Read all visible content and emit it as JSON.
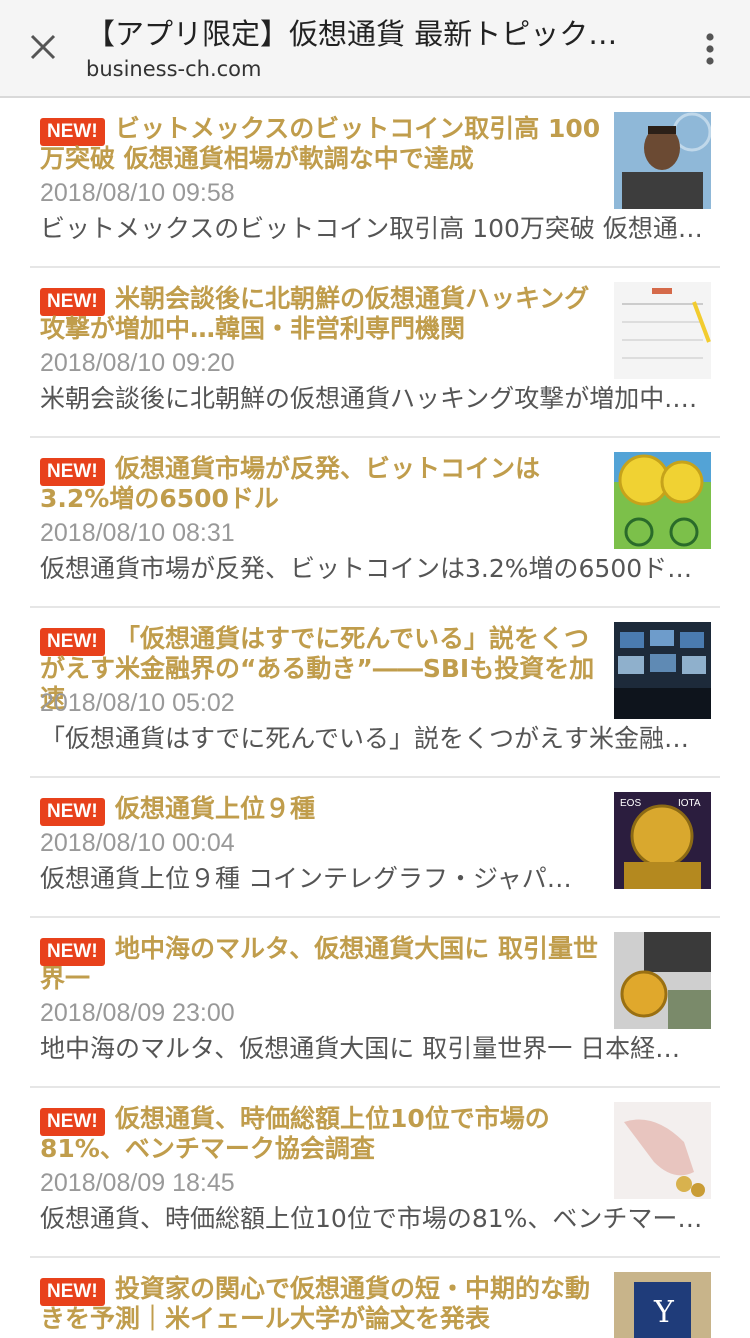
{
  "header": {
    "title": "【アプリ限定】仮想通貨 最新トピック …",
    "url": "business-ch.com"
  },
  "badge_label": "NEW!",
  "articles": [
    {
      "title": "ビットメックスのビットコイン取引高 100万突破 仮想通貨相場が軟調な中で達成",
      "date": "2018/08/10 09:58",
      "summary": "ビットメックスのビットコイン取引高 100万突破 仮想通…"
    },
    {
      "title": "米朝会談後に北朝鮮の仮想通貨ハッキング攻撃が増加中…韓国・非営利専門機関",
      "date": "2018/08/10 09:20",
      "summary": "米朝会談後に北朝鮮の仮想通貨ハッキング攻撃が増加中.…"
    },
    {
      "title": "仮想通貨市場が反発、ビットコインは3.2%増の6500ドル",
      "date": "2018/08/10 08:31",
      "summary": "仮想通貨市場が反発、ビットコインは3.2%増の6500ド…"
    },
    {
      "title": "「仮想通貨はすでに死んでいる」説をくつがえす米金融界の“ある動き”――SBIも投資を加速",
      "date": "2018/08/10 05:02",
      "summary": "「仮想通貨はすでに死んでいる」説をくつがえす米金融界…"
    },
    {
      "title": "仮想通貨上位９種",
      "date": "2018/08/10 00:04",
      "summary": "仮想通貨上位９種 コインテレグラフ・ジャパ…"
    },
    {
      "title": "地中海のマルタ、仮想通貨大国に 取引量世界一",
      "date": "2018/08/09 23:00",
      "summary": "地中海のマルタ、仮想通貨大国に 取引量世界一 日本経…"
    },
    {
      "title": "仮想通貨、時価総額上位10位で市場の81%、ベンチマーク協会調査",
      "date": "2018/08/09 18:45",
      "summary": "仮想通貨、時価総額上位10位で市場の81%、ベンチマー…"
    },
    {
      "title": "投資家の関心で仮想通貨の短・中期的な動きを予測｜米イェール大学が論文を発表",
      "date": "",
      "summary": ""
    }
  ],
  "thumb_labels": {
    "eos": "EOS",
    "iota": "IOTA"
  }
}
